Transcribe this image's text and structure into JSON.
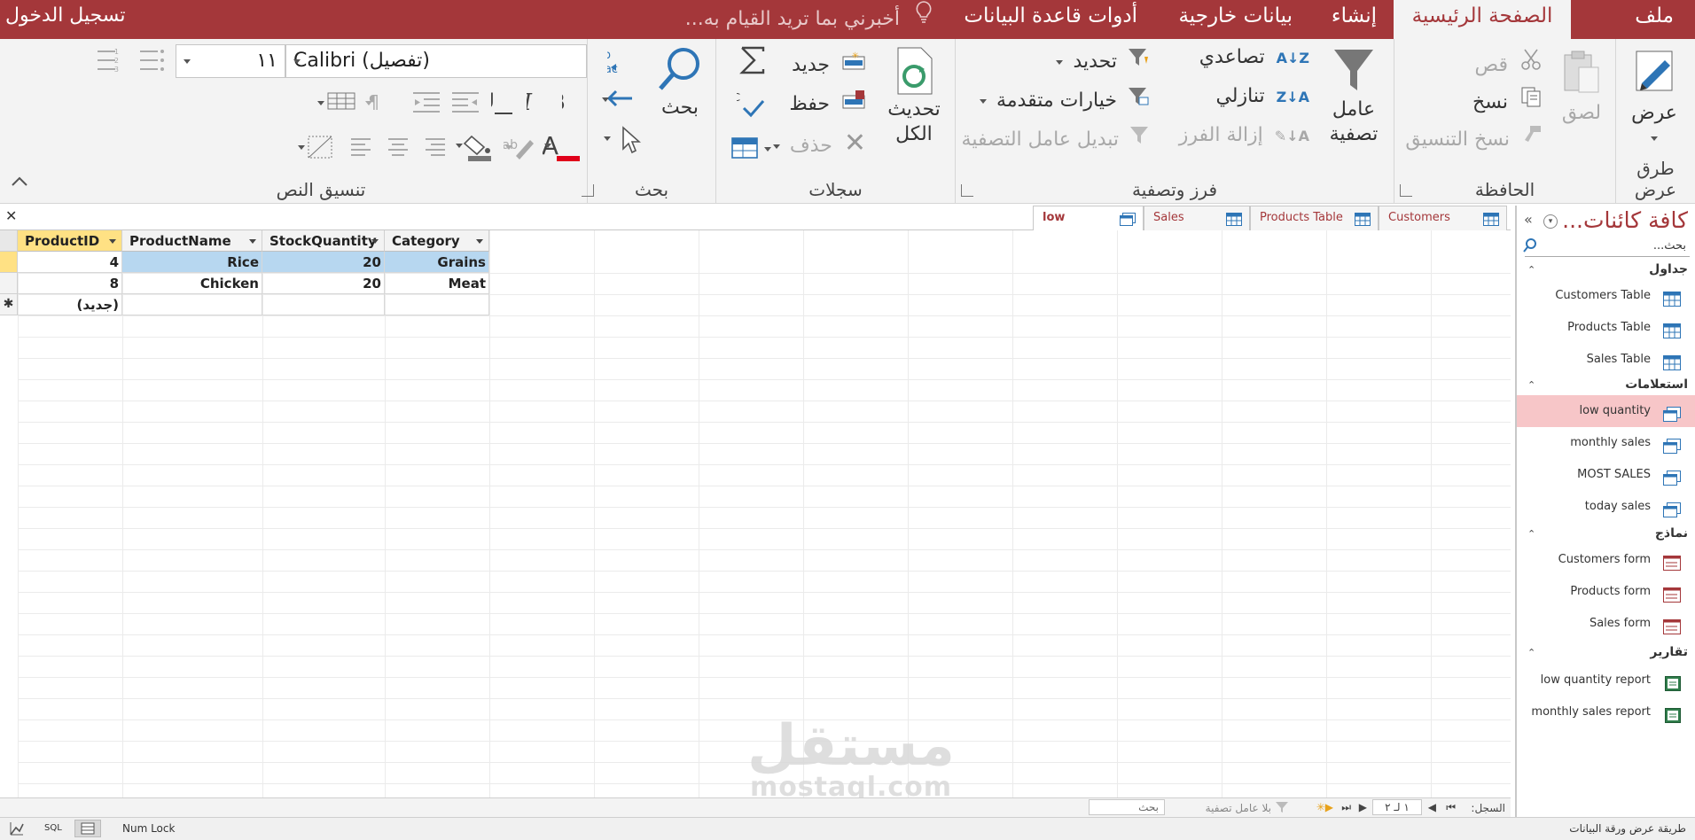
{
  "menu": {
    "tabs": [
      "ملف",
      "الصفحة الرئيسية",
      "إنشاء",
      "بيانات خارجية",
      "أدوات قاعدة البيانات"
    ],
    "active_tab": "الصفحة الرئيسية",
    "tell_me": "أخبرني بما تريد القيام به...",
    "sign_in": "تسجيل الدخول"
  },
  "ribbon": {
    "views": {
      "label": "عرض",
      "group": "طرق عرض"
    },
    "clipboard": {
      "paste": "لصق",
      "cut": "قص",
      "copy": "نسخ",
      "format_painter": "نسخ التنسيق",
      "group": "الحافظة"
    },
    "sort_filter": {
      "filter": "عامل تصفية",
      "ascending": "تصاعدي",
      "descending": "تنازلي",
      "remove_sort": "إزالة الفرز",
      "selection": "تحديد",
      "advanced": "خيارات متقدمة",
      "toggle_filter": "تبديل عامل التصفية",
      "group": "فرز وتصفية"
    },
    "records": {
      "refresh_all": "تحديث الكل",
      "new": "جديد",
      "save": "حفظ",
      "delete": "حذف",
      "group": "سجلات"
    },
    "find": {
      "find": "بحث",
      "group": "بحث"
    },
    "text_formatting": {
      "font": "Calibri (تفصيل)",
      "size": "١١",
      "group": "تنسيق النص"
    }
  },
  "nav": {
    "title": "كافة كائنات...",
    "search_placeholder": "بحث...",
    "sections": [
      {
        "title": "جداول",
        "items": [
          "Customers Table",
          "Products Table",
          "Sales Table"
        ]
      },
      {
        "title": "استعلامات",
        "items": [
          "low quantity",
          "monthly sales",
          "MOST SALES",
          "today sales"
        ]
      },
      {
        "title": "نماذج",
        "items": [
          "Customers form",
          "Products form",
          "Sales form"
        ]
      },
      {
        "title": "تقارير",
        "items": [
          "low quantity report",
          "monthly sales report"
        ]
      }
    ],
    "selected": "low quantity"
  },
  "doc_tabs": [
    "Customers Table",
    "Products Table",
    "Sales Table",
    "low quantity"
  ],
  "active_doc_tab": "low quantity",
  "datasheet": {
    "columns": [
      "ProductID",
      "ProductName",
      "StockQuantity",
      "Category"
    ],
    "rows": [
      [
        "4",
        "Rice",
        "20",
        "Grains"
      ],
      [
        "8",
        "Chicken",
        "20",
        "Meat"
      ]
    ],
    "new_row_label": "(جديد)"
  },
  "record_nav": {
    "label": "السجل:",
    "position": "١ لـ ٢",
    "filter_status": "بلا عامل تصفية",
    "search": "بحث"
  },
  "status": {
    "view_name": "طريقة عرض ورقة البيانات",
    "num_lock": "Num Lock",
    "sql": "SQL"
  },
  "watermark": {
    "arabic": "مستقل",
    "latin": "mostaql.com"
  },
  "colors": {
    "accent": "#a4373a",
    "selected_row": "#f7c6c8",
    "cell_selection": "#b7d7f0",
    "current_record": "#ffe184"
  }
}
